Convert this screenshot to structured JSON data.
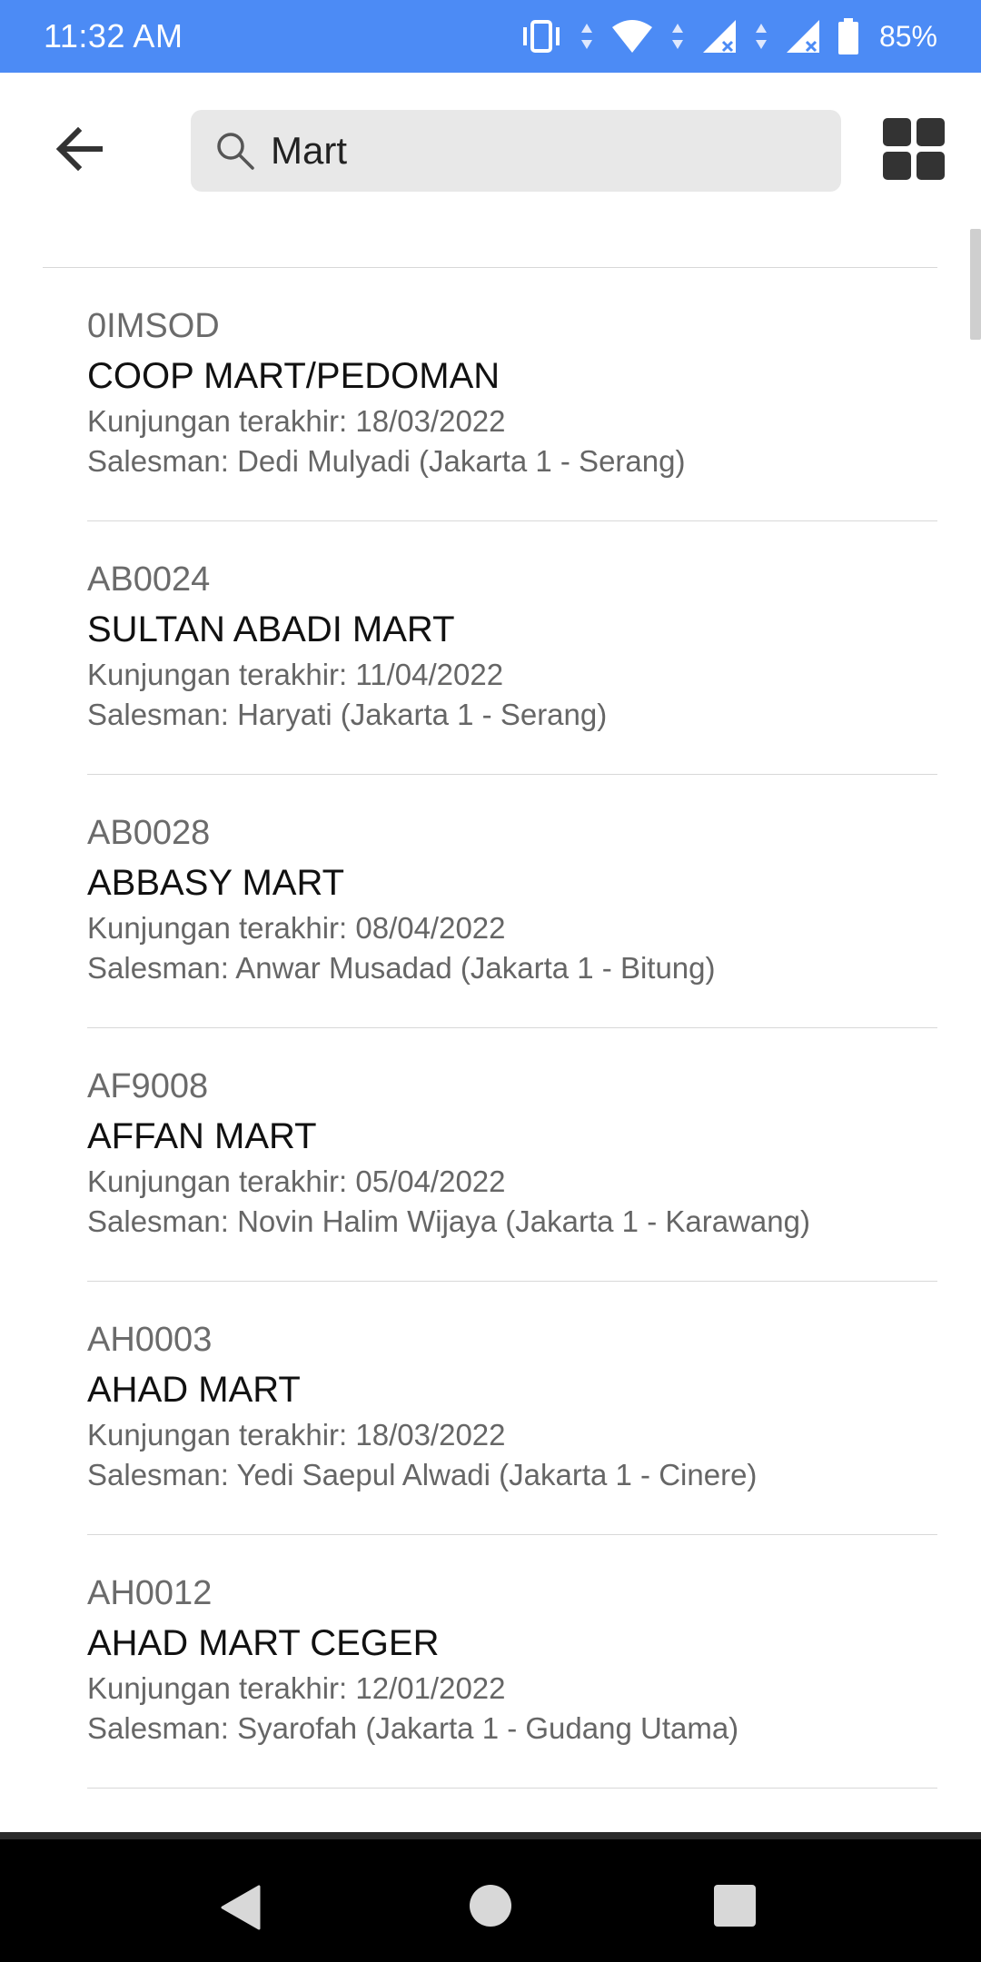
{
  "status_bar": {
    "time": "11:32 AM",
    "battery": "85%"
  },
  "search": {
    "value": "Mart",
    "placeholder": ""
  },
  "results": [
    {
      "code": "0IMSOD",
      "name": "COOP MART/PEDOMAN",
      "last_visit": "Kunjungan terakhir: 18/03/2022",
      "salesman": "Salesman: Dedi Mulyadi (Jakarta 1 - Serang)"
    },
    {
      "code": "AB0024",
      "name": "SULTAN ABADI MART",
      "last_visit": "Kunjungan terakhir: 11/04/2022",
      "salesman": "Salesman: Haryati (Jakarta 1 - Serang)"
    },
    {
      "code": "AB0028",
      "name": "ABBASY MART",
      "last_visit": "Kunjungan terakhir: 08/04/2022",
      "salesman": "Salesman: Anwar Musadad (Jakarta 1 - Bitung)"
    },
    {
      "code": "AF9008",
      "name": "AFFAN MART",
      "last_visit": "Kunjungan terakhir: 05/04/2022",
      "salesman": "Salesman: Novin Halim Wijaya (Jakarta 1 - Karawang)"
    },
    {
      "code": "AH0003",
      "name": "AHAD MART",
      "last_visit": "Kunjungan terakhir: 18/03/2022",
      "salesman": "Salesman: Yedi Saepul Alwadi (Jakarta 1 - Cinere)"
    },
    {
      "code": "AH0012",
      "name": "AHAD MART CEGER",
      "last_visit": "Kunjungan terakhir: 12/01/2022",
      "salesman": "Salesman: Syarofah (Jakarta 1 - Gudang Utama)"
    }
  ],
  "icons": {
    "back": "arrow-back-icon",
    "search": "search-icon",
    "view_toggle": "grid-view-icon",
    "nav_back": "nav-back-icon",
    "nav_home": "nav-home-icon",
    "nav_recent": "nav-recent-apps-icon"
  },
  "colors": {
    "status_bar": "#4c8bf5",
    "search_bg": "#e8e8e8",
    "nav_bar": "#000000"
  }
}
